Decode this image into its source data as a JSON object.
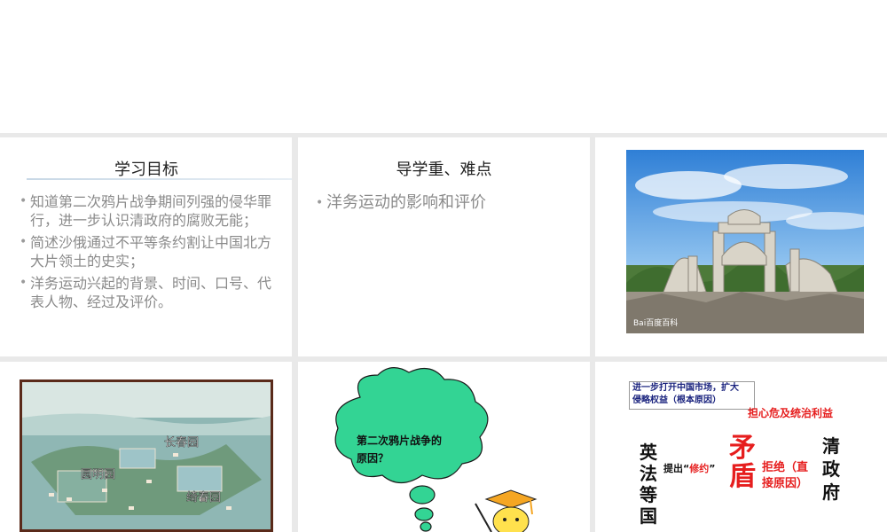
{
  "slide1": {
    "title": "学习目标",
    "bullets": [
      "知道第二次鸦片战争期间列强的侵华罪行，进一步认识清政府的腐败无能；",
      "简述沙俄通过不平等条约割让中国北方大片领土的史实；",
      "洋务运动兴起的背景、时间、口号、代表人物、经过及评价。"
    ]
  },
  "slide2": {
    "title": "导学重、难点",
    "bullets": [
      "洋务运动的影响和评价"
    ]
  },
  "slide3": {
    "watermark": "Bai百度百科"
  },
  "slide4": {
    "labels": {
      "changchun": "长春园",
      "yuanming": "圆明园",
      "qichun": "绮春园"
    }
  },
  "slide5": {
    "bubble_text_line1": "第二次鸦片战争的",
    "bubble_text_line2": "原因？"
  },
  "slide6": {
    "box_line1": "进一步打开中国市场，扩大",
    "box_line2": "侵略权益（根本原因）",
    "worry": "担心危及统治利益",
    "left_party": [
      "英",
      "法",
      "等",
      "国"
    ],
    "propose_prefix": "提出“",
    "propose_word": "修约",
    "propose_suffix": "”",
    "conflict": [
      "矛",
      "盾"
    ],
    "reject_line1": "拒绝（直",
    "reject_line2": "接原因）",
    "right_party": [
      "清",
      "政",
      "府"
    ]
  },
  "colors": {
    "grid_gap": "#e9e9e9",
    "bullet_text": "#8a8a8a",
    "bubble_green": "#33d494",
    "accent_red": "#e61e1e",
    "box_blue": "#1a237e"
  }
}
